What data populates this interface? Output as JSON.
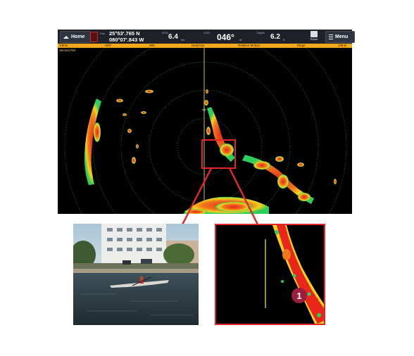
{
  "topbar": {
    "home_label": "Home",
    "position_label": "Pos",
    "lat": "25°53'.765 N",
    "lon": "080°07'.843 W",
    "sog_label": "SOG",
    "sog_value": "6.4",
    "sog_unit": "kts",
    "cog_label": "COG",
    "cog_value": "046°",
    "cog_unit": "M",
    "depth_label": "Depth",
    "depth_value": "6.2",
    "depth_unit": "ft",
    "radar_button_label": "Radar",
    "menu_label": "Menu"
  },
  "infobar": {
    "range": "1/8nm",
    "gain": "-000°",
    "bearing": "088",
    "orientation": "Head-Up",
    "motion": "Relative Motion",
    "rings_label": "Rings",
    "ring_spacing": "1/8nm",
    "vectors": "Vectors Rel"
  },
  "callout": {
    "number": "1"
  },
  "colors": {
    "radar_strong": "#e8261c",
    "radar_mid": "#f5d21c",
    "radar_weak": "#2ccf5a",
    "info_bar": "#f2a81c",
    "callout_marker": "#9b1e3e",
    "highlight_box": "#e0262b",
    "heading_line": "#f4f25a"
  }
}
